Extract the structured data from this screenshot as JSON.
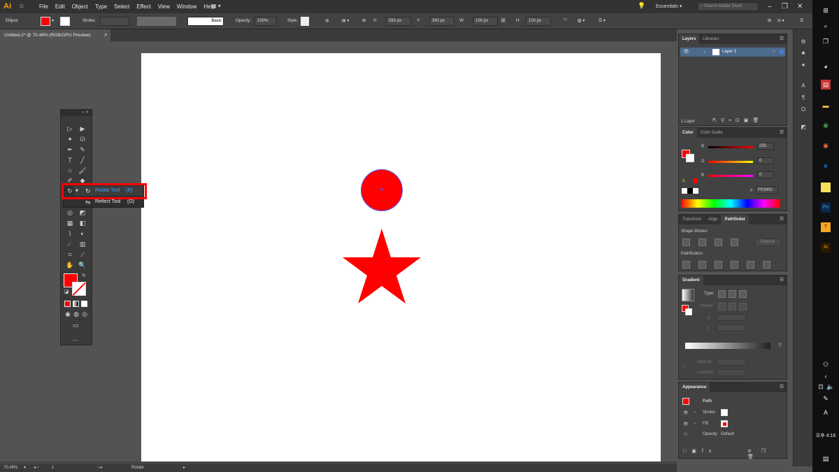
{
  "menubar": {
    "logo": "Ai",
    "menus": [
      "File",
      "Edit",
      "Object",
      "Type",
      "Select",
      "Effect",
      "View",
      "Window",
      "Help"
    ],
    "workspace": "Essentials",
    "search_placeholder": "Search Adobe Stock"
  },
  "control": {
    "selection": "Ellipse",
    "stroke_label": "Stroke:",
    "brush": "Basic",
    "opacity_label": "Opacity:",
    "opacity": "100%",
    "style_label": "Style:",
    "x_label": "X:",
    "x": "593 px",
    "y_label": "Y:",
    "y": "340 px",
    "w_label": "W:",
    "w": "100 px",
    "h_label": "H:",
    "h": "100 px"
  },
  "document": {
    "tab": "Untitled-2* @ 70.48% (RGB/GPU Preview)"
  },
  "flyout": {
    "rotate_name": "Rotate Tool",
    "rotate_key": "(R)",
    "reflect_name": "Reflect Tool",
    "reflect_key": "(O)"
  },
  "layers": {
    "tabs": [
      "Layers",
      "Libraries"
    ],
    "layer_name": "Layer 1",
    "count": "1 Layer"
  },
  "color": {
    "tabs": [
      "Color",
      "Color Guide"
    ],
    "r_label": "R",
    "r": "255",
    "g_label": "G",
    "g": "0",
    "b_label": "B",
    "b": "0",
    "hex_label": "#",
    "hex": "FF0000",
    "fill": "#ff0000"
  },
  "pathfinder": {
    "tabs": [
      "Transform",
      "Align",
      "Pathfinder"
    ],
    "shape_modes": "Shape Modes:",
    "pathfinders": "Pathfinders:",
    "expand": "Expand"
  },
  "gradient": {
    "title": "Gradient",
    "type": "Type:",
    "stroke": "Stroke:",
    "opacity": "Opacity:",
    "location": "Location:"
  },
  "appearance": {
    "title": "Appearance",
    "path": "Path",
    "stroke": "Stroke:",
    "fill": "Fill:",
    "opacity": "Opacity:",
    "opacity_value": "Default"
  },
  "status": {
    "zoom": "70.48%",
    "artboard": "1",
    "tool": "Rotate"
  },
  "taskbar": {
    "time": "오후 4:16",
    "lang": "A"
  }
}
